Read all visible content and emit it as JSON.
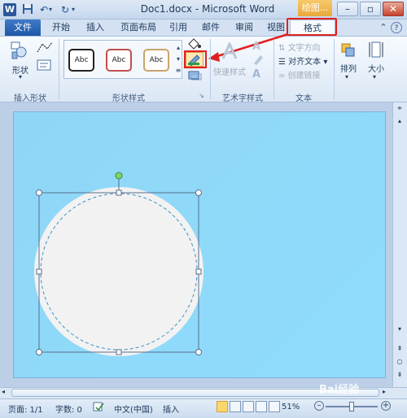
{
  "title_bar": {
    "app_icon": "W",
    "title": "Doc1.docx - Microsoft Word",
    "context_tab_header": "绘图...",
    "save_icon": "save-icon",
    "undo_icon": "undo-icon",
    "redo_icon": "redo-icon"
  },
  "tabs": [
    {
      "label": "文件"
    },
    {
      "label": "开始"
    },
    {
      "label": "插入"
    },
    {
      "label": "页面布局"
    },
    {
      "label": "引用"
    },
    {
      "label": "邮件"
    },
    {
      "label": "审阅"
    },
    {
      "label": "视图"
    },
    {
      "label": "格式"
    }
  ],
  "ribbon": {
    "insert_shapes": {
      "shapes_label": "形状",
      "group_label": "插入形状"
    },
    "shape_styles": {
      "styles": [
        "Abc",
        "Abc",
        "Abc"
      ],
      "group_label": "形状样式"
    },
    "wordart_styles": {
      "quick_styles_label": "快速样式",
      "group_label": "艺术字样式"
    },
    "text": {
      "text_direction": "文字方向",
      "align_text": "对齐文本",
      "create_link": "创建链接",
      "group_label": "文本"
    },
    "arrange": {
      "label": "排列"
    },
    "size": {
      "label": "大小"
    }
  },
  "status_bar": {
    "page": "页面: 1/1",
    "words": "字数: 0",
    "language": "中文(中国)",
    "insert_mode": "插入",
    "zoom": "51%"
  },
  "watermark": "Bai经验",
  "colors": {
    "accent": "#2b579a",
    "page_background": "#8fd8f8",
    "highlight": "#e02020",
    "circle_fill": "#f2f2f2"
  }
}
